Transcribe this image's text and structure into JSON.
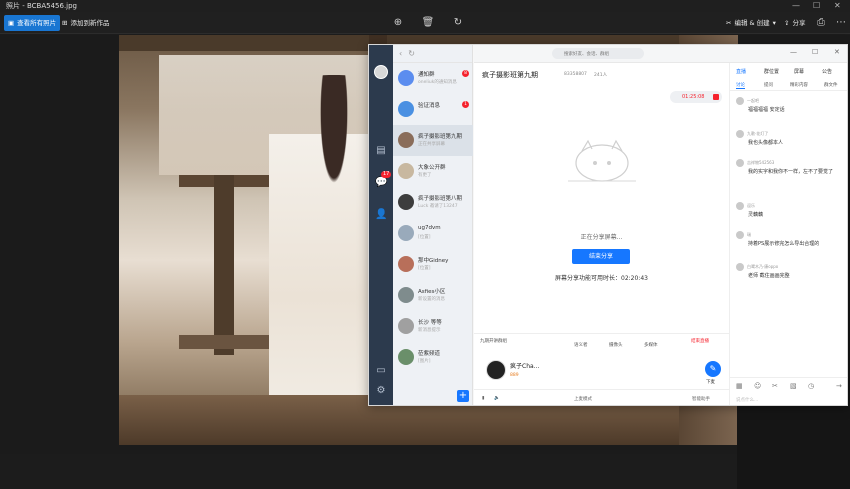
{
  "window": {
    "title": "照片 - BCBA5456.jpg"
  },
  "window_controls": [
    "—",
    "☐",
    "✕"
  ],
  "toolbar": {
    "view_all": "查看所有照片",
    "add_to": "添加到新作品",
    "edit_create": "编辑 & 创建",
    "share": "分享",
    "icons": [
      "zoom-in-icon",
      "delete-icon",
      "rotate-icon",
      "print-icon",
      "more-icon"
    ]
  },
  "app": {
    "search_placeholder": "搜索好友、会话、群组",
    "nav_icons": [
      "back-icon",
      "forward-icon",
      "refresh-icon"
    ],
    "rail_badge": "17",
    "conversations": [
      {
        "name": "通知群",
        "preview": "oneliuk的通知消息",
        "badge": "8",
        "color": "#5b8def"
      },
      {
        "name": "验证消息",
        "preview": "",
        "badge": "1",
        "color": "#4a90e2"
      },
      {
        "name": "疯子摄影班第九期",
        "preview": "正在共享屏幕",
        "badge": "",
        "color": "#8a6d5a"
      },
      {
        "name": "大象公开群",
        "preview": "有更了",
        "badge": "",
        "color": "#c8b8a0"
      },
      {
        "name": "疯子摄影班第八期",
        "preview": "Luck 邀请了13247",
        "badge": "",
        "color": "#3d3d3d"
      },
      {
        "name": "ug7dvm",
        "preview": "[位置]",
        "badge": "",
        "color": "#9ab"
      },
      {
        "name": "那中Gidney",
        "preview": "[位置]",
        "badge": "",
        "color": "#b86f5a"
      },
      {
        "name": "Asfies小区",
        "preview": "新设置的消息",
        "badge": "",
        "color": "#7f8c8d"
      },
      {
        "name": "长沙 等等",
        "preview": "新消息提示",
        "badge": "",
        "color": "#a0a0a0"
      },
      {
        "name": "莅紫频道",
        "preview": "[图片]",
        "badge": "",
        "color": "#6a8f6a"
      }
    ],
    "chat": {
      "title": "疯子摄影班第九期",
      "group_id": "83358807",
      "member_count": "241人",
      "rec_time": "01:25:08",
      "sharing_text": "正在分享屏幕...",
      "end_button": "结束分享",
      "remaining": "屏幕分享功能可用时长：02:20:43",
      "ctrl": {
        "share_label": "九期开讲群组",
        "voice": "语义者",
        "camera": "摄像头",
        "screen": "多媒体",
        "end_live": "结束直播"
      },
      "presenter": {
        "name": "疯子Cha...",
        "fans": "889"
      },
      "follow_label": "下麦",
      "bottom": {
        "mode": "上麦模式",
        "assistant": "智能助手"
      }
    },
    "side": {
      "top_tabs": [
        "直播",
        "群位置",
        "屏幕",
        "公告"
      ],
      "tabs": [
        "讨论",
        "提问",
        "精彩内容",
        "群文件"
      ],
      "active_tab": "讨论",
      "messages": [
        {
          "name": "一起吧",
          "text": "福福福福 安定话"
        },
        {
          "name": "九歌·花灯了",
          "text": "我也头像都本人"
        },
        {
          "name": "吉祥物542563",
          "text": "我的实字和我你不一样，左不了要觉了"
        },
        {
          "name": "逗乐",
          "text": "灵藕藕"
        },
        {
          "name": "瑞",
          "text": "持着PS展示修完怎么导出合理的"
        },
        {
          "name": "白鹭木乃·康oppo",
          "text": "老师 截住画画完整"
        }
      ],
      "compose_placeholder": "说点什么..."
    }
  }
}
